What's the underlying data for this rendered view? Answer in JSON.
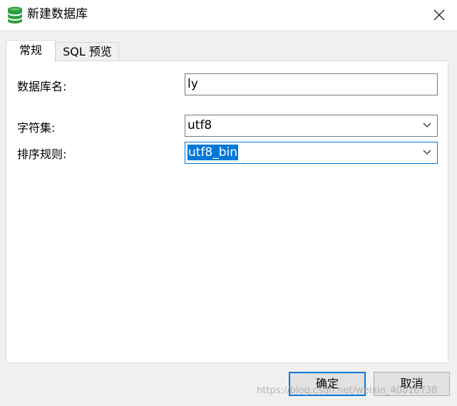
{
  "window": {
    "title": "新建数据库",
    "icon": "database-icon",
    "close": "close-icon"
  },
  "tabs": [
    {
      "label": "常规",
      "active": true
    },
    {
      "label": "SQL 预览",
      "active": false
    }
  ],
  "form": {
    "db_name": {
      "label": "数据库名:",
      "value": "ly"
    },
    "charset": {
      "label": "字符集:",
      "value": "utf8"
    },
    "collation": {
      "label": "排序规则:",
      "value": "utf8_bin"
    }
  },
  "buttons": {
    "ok": "确定",
    "cancel": "取消"
  },
  "watermark": "https://blog.csdn.net/weixin_40010738",
  "colors": {
    "accent": "#0078d7",
    "db_icon": "#2e9e3f"
  }
}
